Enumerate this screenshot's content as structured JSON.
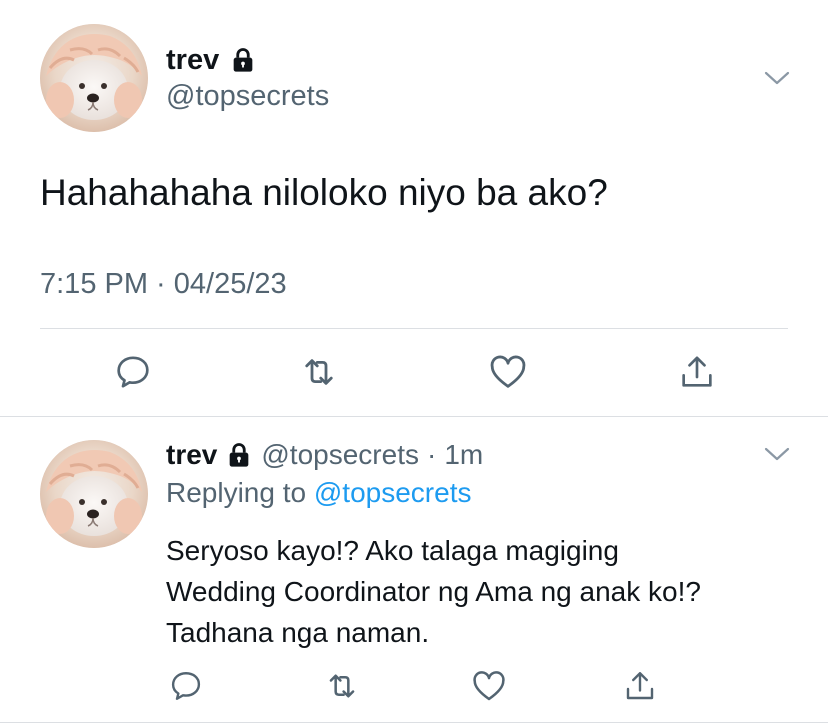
{
  "colors": {
    "text_primary": "#0f1419",
    "text_secondary": "#536471",
    "link": "#1d9bf0",
    "divider": "#dcdfe3",
    "icon": "#536471"
  },
  "main_tweet": {
    "display_name": "trev",
    "handle": "@topsecrets",
    "protected_icon": "lock-icon",
    "text": "Hahahahaha nilolo​ko niyo ba ako?",
    "timestamp": "7:15 PM · 04/25/23",
    "actions": [
      "reply-icon",
      "retweet-icon",
      "like-icon",
      "share-icon"
    ]
  },
  "reply_tweet": {
    "display_name": "trev",
    "handle": "@topsecrets",
    "separator": "·",
    "time": "1m",
    "replying_label": "Replying to",
    "replying_to": "@topsecrets",
    "text_lines": [
      "Seryoso kayo!? Ako talaga magiging",
      "Wedding Coordinator ng Ama ng anak ko!?",
      "Tadhana nga naman."
    ],
    "actions": [
      "reply-icon",
      "retweet-icon",
      "like-icon",
      "share-icon"
    ]
  }
}
